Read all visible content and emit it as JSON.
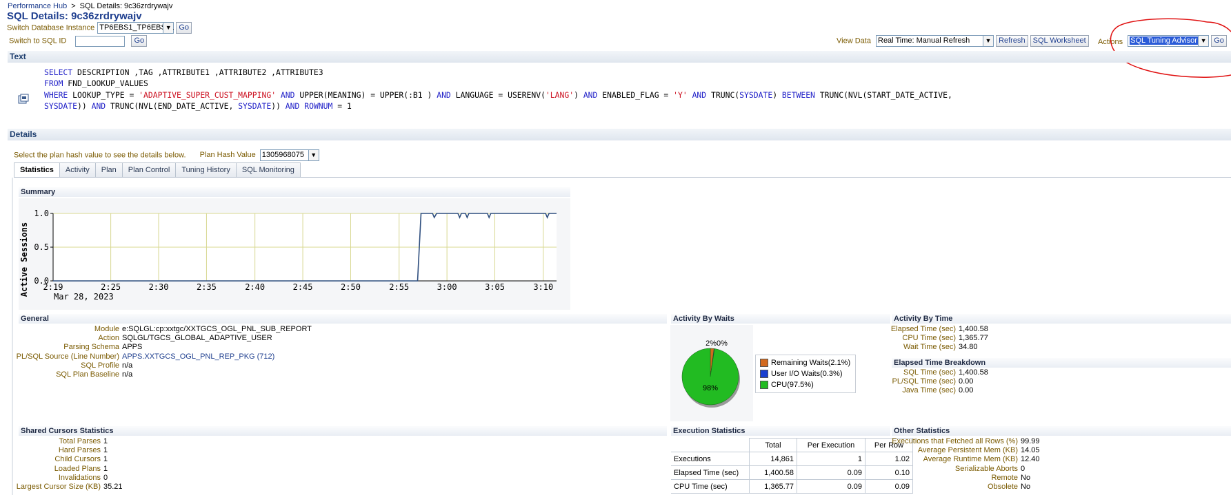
{
  "breadcrumb": {
    "root": "Performance Hub",
    "separator": ">",
    "current": "SQL Details: 9c36zrdrywajv"
  },
  "page_title": "SQL Details: 9c36zrdrywajv",
  "instance": {
    "label": "Switch Database Instance",
    "value": "TP6EBS1_TP6EBS11",
    "go": "Go"
  },
  "sqlid": {
    "label": "Switch to SQL ID",
    "value": "",
    "go": "Go"
  },
  "viewdata": {
    "label": "View Data",
    "value": "Real Time: Manual Refresh",
    "refresh": "Refresh",
    "worksheet": "SQL Worksheet"
  },
  "actions": {
    "label": "Actions",
    "value": "SQL Tuning Advisor",
    "go": "Go"
  },
  "sections": {
    "text": "Text",
    "details": "Details"
  },
  "sql_text": {
    "l1_a": "SELECT",
    "l1_b": " DESCRIPTION ,TAG ,ATTRIBUTE1 ,ATTRIBUTE2 ,ATTRIBUTE3",
    "l2_a": "FROM",
    "l2_b": " FND_LOOKUP_VALUES",
    "l3_a": "WHERE",
    "l3_b": " LOOKUP_TYPE = ",
    "l3_c": "'ADAPTIVE_SUPER_CUST_MAPPING'",
    "l3_d": " AND",
    "l3_e": " UPPER(MEANING) = UPPER(:B1 ) ",
    "l3_f": "AND",
    "l3_g": " LANGUAGE = USERENV(",
    "l3_h": "'LANG'",
    "l3_i": ") ",
    "l3_j": "AND",
    "l3_k": " ENABLED_FLAG = ",
    "l3_l": "'Y'",
    "l3_m": " AND",
    "l3_n": " TRUNC(",
    "l3_o": "SYSDATE",
    "l3_p": ") ",
    "l3_q": "BETWEEN",
    "l3_r": " TRUNC(NVL(START_DATE_ACTIVE,",
    "l4_a": "SYSDATE",
    "l4_b": ")) ",
    "l4_c": "AND",
    "l4_d": " TRUNC(NVL(END_DATE_ACTIVE, ",
    "l4_e": "SYSDATE",
    "l4_f": ")) ",
    "l4_g": "AND",
    "l4_h": " ROWNUM",
    "l4_i": " = 1"
  },
  "plan": {
    "hint": "Select the plan hash value to see the details below.",
    "label": "Plan Hash Value",
    "value": "1305968075"
  },
  "tabs": [
    "Statistics",
    "Activity",
    "Plan",
    "Plan Control",
    "Tuning History",
    "SQL Monitoring"
  ],
  "summary": {
    "title": "Summary"
  },
  "chart_data": {
    "type": "line",
    "ylabel": "Active Sessions",
    "xlabel": "",
    "date_label": "Mar 28, 2023",
    "ylim": [
      0,
      1.0
    ],
    "yticks": [
      "0.0",
      "0.5",
      "1.0"
    ],
    "xticks": [
      "2:19",
      "2:25",
      "2:30",
      "2:35",
      "2:40",
      "2:45",
      "2:50",
      "2:55",
      "3:00",
      "3:05",
      "3:10",
      "3:15"
    ],
    "grid": true,
    "series": [
      {
        "color": "#2f4f7f",
        "x": [
          2.317,
          2.949,
          2.955,
          2.975,
          2.978,
          2.982,
          3.019,
          3.022,
          3.025,
          3.032,
          3.035,
          3.038,
          3.07,
          3.073,
          3.076,
          3.171,
          3.174,
          3.177,
          3.19
        ],
        "y": [
          0,
          0,
          1.0,
          1.0,
          0.94,
          1.0,
          1.0,
          0.94,
          1.0,
          1.0,
          0.94,
          1.0,
          1.0,
          0.94,
          1.0,
          1.0,
          0.94,
          1.0,
          1.0
        ]
      }
    ]
  },
  "general": {
    "title": "General",
    "rows": [
      {
        "k": "Module",
        "v": "e:SQLGL:cp:xxtgc/XXTGCS_OGL_PNL_SUB_REPORT"
      },
      {
        "k": "Action",
        "v": "SQLGL/TGCS_GLOBAL_ADAPTIVE_USER"
      },
      {
        "k": "Parsing Schema",
        "v": "APPS"
      },
      {
        "k": "PL/SQL Source (Line Number)",
        "v": "APPS.XXTGCS_OGL_PNL_REP_PKG (712)"
      },
      {
        "k": "SQL Profile",
        "v": "n/a"
      },
      {
        "k": "SQL Plan Baseline",
        "v": "n/a"
      }
    ]
  },
  "waits": {
    "title": "Activity By Waits",
    "pie_top_label": "2%0%",
    "pie_main_label": "98%",
    "legend": [
      {
        "label": "Remaining Waits(2.1%)",
        "color": "#d2691e",
        "value": 2.1
      },
      {
        "label": "User I/O Waits(0.3%)",
        "color": "#1a3fd0",
        "value": 0.3
      },
      {
        "label": "CPU(97.5%)",
        "color": "#22bb22",
        "value": 97.5
      }
    ]
  },
  "activity_time": {
    "title": "Activity By Time",
    "rows": [
      {
        "k": "Elapsed Time (sec)",
        "v": "1,400.58"
      },
      {
        "k": "CPU Time (sec)",
        "v": "1,365.77"
      },
      {
        "k": "Wait Time (sec)",
        "v": "34.80"
      }
    ]
  },
  "elapsed_breakdown": {
    "title": "Elapsed Time Breakdown",
    "rows": [
      {
        "k": "SQL Time (sec)",
        "v": "1,400.58"
      },
      {
        "k": "PL/SQL Time (sec)",
        "v": "0.00"
      },
      {
        "k": "Java Time (sec)",
        "v": "0.00"
      }
    ]
  },
  "shared_cursors": {
    "title": "Shared Cursors Statistics",
    "rows": [
      {
        "k": "Total Parses",
        "v": "1"
      },
      {
        "k": "Hard Parses",
        "v": "1"
      },
      {
        "k": "Child Cursors",
        "v": "1"
      },
      {
        "k": "Loaded Plans",
        "v": "1"
      },
      {
        "k": "Invalidations",
        "v": "0"
      },
      {
        "k": "Largest Cursor Size (KB)",
        "v": "35.21"
      }
    ]
  },
  "exec_stats": {
    "title": "Execution Statistics",
    "headers": [
      "",
      "Total",
      "Per Execution",
      "Per Row"
    ],
    "rows": [
      [
        "Executions",
        "14,861",
        "1",
        "1.02"
      ],
      [
        "Elapsed Time (sec)",
        "1,400.58",
        "0.09",
        "0.10"
      ],
      [
        "CPU Time (sec)",
        "1,365.77",
        "0.09",
        "0.09"
      ]
    ]
  },
  "other_stats": {
    "title": "Other Statistics",
    "rows": [
      {
        "k": "Executions that Fetched all Rows (%)",
        "v": "99.99"
      },
      {
        "k": "Average Persistent Mem (KB)",
        "v": "14.05"
      },
      {
        "k": "Average Runtime Mem (KB)",
        "v": "12.40"
      },
      {
        "k": "Serializable Aborts",
        "v": "0"
      },
      {
        "k": "Remote",
        "v": "No"
      },
      {
        "k": "Obsolete",
        "v": "No"
      }
    ]
  }
}
